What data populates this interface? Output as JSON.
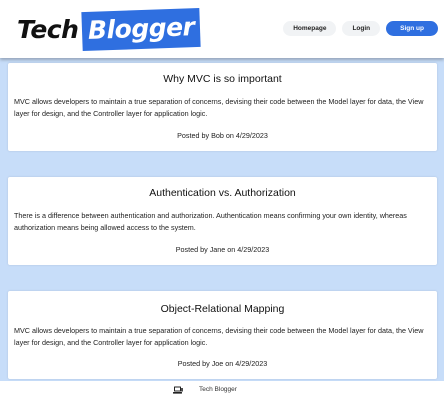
{
  "header": {
    "logo_part1": "Tech",
    "logo_part2": "Blogger",
    "nav": {
      "homepage": "Homepage",
      "login": "Login",
      "signup": "Sign up"
    }
  },
  "posts": [
    {
      "title": "Why MVC is so important",
      "body": "MVC allows developers to maintain a true separation of concerns, devising their code between the Model layer for data, the View layer for design, and the Controller layer for application logic.",
      "meta": "Posted by Bob on 4/29/2023"
    },
    {
      "title": "Authentication vs. Authorization",
      "body": "There is a difference between authentication and authorization. Authentication means confirming your own identity, whereas authorization means being allowed access to the system.",
      "meta": "Posted by Jane on 4/29/2023"
    },
    {
      "title": "Object-Relational Mapping",
      "body": "MVC allows developers to maintain a true separation of concerns, devising their code between the Model layer for data, the View layer for design, and the Controller layer for application logic.",
      "meta": "Posted by Joe on 4/29/2023"
    }
  ],
  "footer": {
    "icon": "laptop-icon",
    "text": "Tech Blogger"
  },
  "colors": {
    "accent": "#2f6fe0",
    "background": "#c7ddf9"
  }
}
